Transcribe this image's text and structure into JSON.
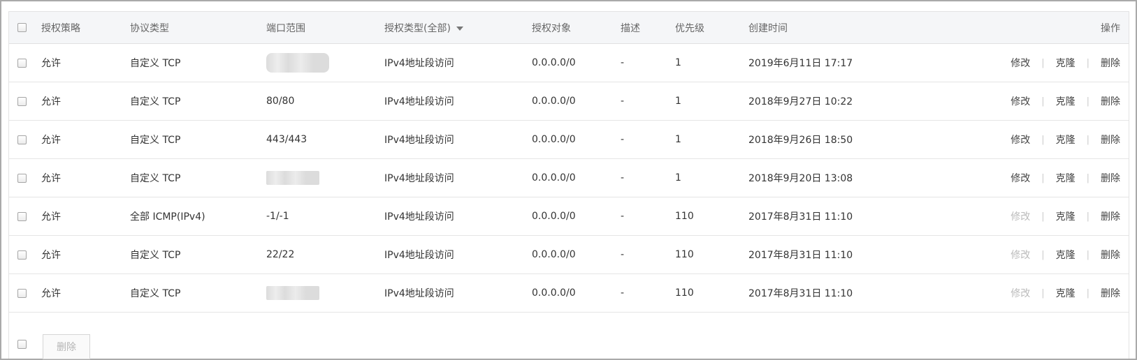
{
  "header": {
    "policy": "授权策略",
    "protocol": "协议类型",
    "port": "端口范围",
    "auth_type": "授权类型(全部)",
    "target": "授权对象",
    "desc": "描述",
    "priority": "优先级",
    "created": "创建时间",
    "ops": "操作"
  },
  "ops_labels": {
    "edit": "修改",
    "clone": "克隆",
    "delete": "删除",
    "separator": "|"
  },
  "rows": [
    {
      "policy": "允许",
      "protocol": "自定义 TCP",
      "port": "",
      "port_blurred": true,
      "auth_type": "IPv4地址段访问",
      "target": "0.0.0.0/0",
      "desc": "-",
      "priority": "1",
      "created": "2019年6月11日 17:17",
      "edit_enabled": true
    },
    {
      "policy": "允许",
      "protocol": "自定义 TCP",
      "port": "80/80",
      "port_blurred": false,
      "auth_type": "IPv4地址段访问",
      "target": "0.0.0.0/0",
      "desc": "-",
      "priority": "1",
      "created": "2018年9月27日 10:22",
      "edit_enabled": true
    },
    {
      "policy": "允许",
      "protocol": "自定义 TCP",
      "port": "443/443",
      "port_blurred": false,
      "auth_type": "IPv4地址段访问",
      "target": "0.0.0.0/0",
      "desc": "-",
      "priority": "1",
      "created": "2018年9月26日 18:50",
      "edit_enabled": true
    },
    {
      "policy": "允许",
      "protocol": "自定义 TCP",
      "port": "",
      "port_blurred": true,
      "auth_type": "IPv4地址段访问",
      "target": "0.0.0.0/0",
      "desc": "-",
      "priority": "1",
      "created": "2018年9月20日 13:08",
      "edit_enabled": true
    },
    {
      "policy": "允许",
      "protocol": "全部 ICMP(IPv4)",
      "port": "-1/-1",
      "port_blurred": false,
      "auth_type": "IPv4地址段访问",
      "target": "0.0.0.0/0",
      "desc": "-",
      "priority": "110",
      "created": "2017年8月31日 11:10",
      "edit_enabled": false
    },
    {
      "policy": "允许",
      "protocol": "自定义 TCP",
      "port": "22/22",
      "port_blurred": false,
      "auth_type": "IPv4地址段访问",
      "target": "0.0.0.0/0",
      "desc": "-",
      "priority": "110",
      "created": "2017年8月31日 11:10",
      "edit_enabled": false
    },
    {
      "policy": "允许",
      "protocol": "自定义 TCP",
      "port": "",
      "port_blurred": true,
      "auth_type": "IPv4地址段访问",
      "target": "0.0.0.0/0",
      "desc": "-",
      "priority": "110",
      "created": "2017年8月31日 11:10",
      "edit_enabled": false
    }
  ],
  "footer": {
    "delete_button": "删除"
  }
}
